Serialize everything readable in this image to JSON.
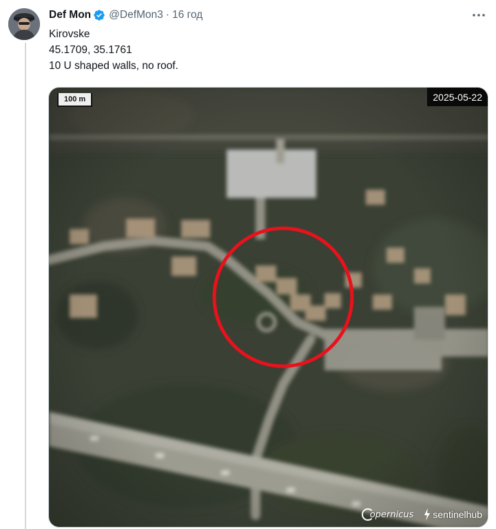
{
  "author": {
    "display_name": "Def Mon",
    "handle": "@DefMon3",
    "separator": "·",
    "time": "16 год",
    "verified": true
  },
  "tweet": {
    "lines": [
      "Kirovske",
      "45.1709, 35.1761",
      "10 U shaped walls, no roof."
    ]
  },
  "media": {
    "scale_label": "100 m",
    "date_label": "2025-05-22",
    "attribution_copernicus": "opernicus",
    "attribution_sentinelhub": "sentinelhub"
  },
  "icons": {
    "verified": "verified-badge-icon",
    "more": "more-dots-icon",
    "copernicus": "copernicus-logo",
    "sentinelhub": "sentinelhub-logo"
  },
  "colors": {
    "verified_blue": "#1d9bf0",
    "highlight_circle": "#e8121c",
    "secondary_text": "#536471"
  }
}
